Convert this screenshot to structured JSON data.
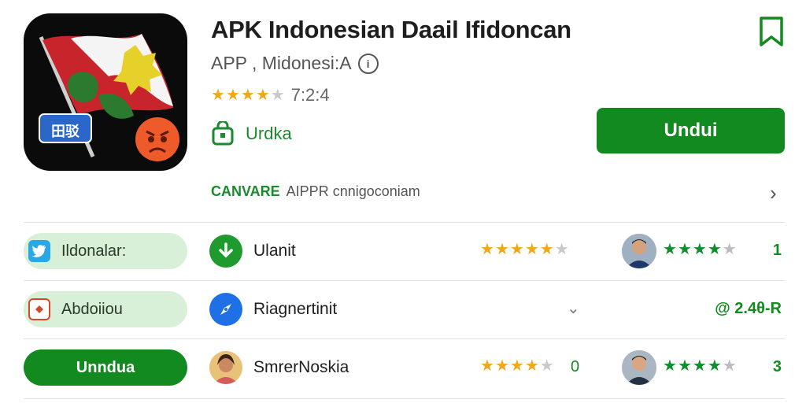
{
  "app": {
    "title": "APK Indonesian Daail Ifidoncan",
    "subtitle": "APP , Midonesi:A",
    "rating_text": "7:2:4",
    "update_label": "Urdka",
    "download_label": "Undui",
    "icon_badge_text": "田驳"
  },
  "approval": {
    "part1": "CANVARE",
    "part2": "AIPPR cnnigoconiam"
  },
  "rows": [
    {
      "pill_label": "Ildonalar:",
      "name": "Ulanit",
      "rating": 4.5,
      "green_rating": 4.5,
      "end_text": "1"
    },
    {
      "pill_label": "Abdoiiou",
      "name": "Riagnertinit",
      "end_text": "@ 2.4θ-R"
    },
    {
      "pill_label": "Unndua",
      "name": "SmrerNoskia",
      "rating": 4,
      "count": "0",
      "green_rating": 4.5,
      "end_text": "3"
    }
  ],
  "colors": {
    "brand_green": "#138a1f",
    "star_gold": "#f0a81a",
    "pill_light": "#d8efd8"
  },
  "icons": {
    "bookmark": "bookmark-icon",
    "info": "info-icon",
    "update": "update-bag-icon",
    "chevron": "chevron-right-icon"
  }
}
